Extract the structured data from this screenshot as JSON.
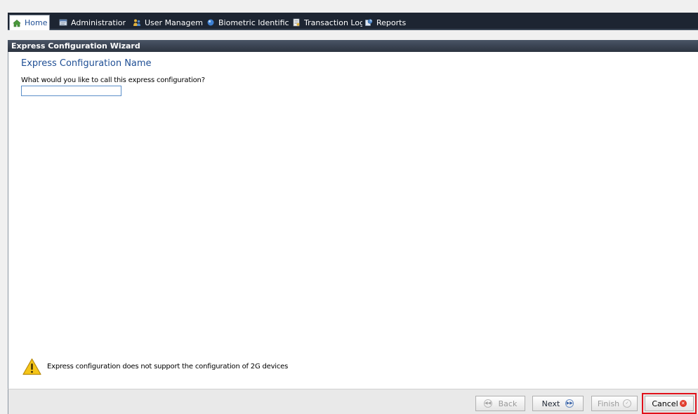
{
  "tabs": [
    {
      "label": "Home",
      "icon": "home-icon",
      "active": true
    },
    {
      "label": "Administratior",
      "icon": "admin-icon",
      "active": false
    },
    {
      "label": "User Managemen",
      "icon": "users-icon",
      "active": false
    },
    {
      "label": "Biometric Identificatic",
      "icon": "biometric-icon",
      "active": false
    },
    {
      "label": "Transaction Log",
      "icon": "transaction-log-icon",
      "active": false
    },
    {
      "label": "Reports",
      "icon": "reports-icon",
      "active": false
    }
  ],
  "panel": {
    "title": "Express Configuration Wizard"
  },
  "step": {
    "title": "Express Configuration Name",
    "prompt": "What would you like to call this express configuration?",
    "input_value": ""
  },
  "warning": {
    "icon": "warning-icon",
    "text": "Express configuration does not support the configuration of 2G devices"
  },
  "footer": {
    "back_label": "Back",
    "next_label": "Next",
    "finish_label": "Finish",
    "cancel_label": "Cancel",
    "back_enabled": false,
    "finish_enabled": false
  },
  "colors": {
    "tabbar_bg": "#1d2532",
    "accent_blue": "#1f4f95",
    "highlight_red": "#e0101a",
    "cancel_icon_red": "#e03a2a"
  }
}
